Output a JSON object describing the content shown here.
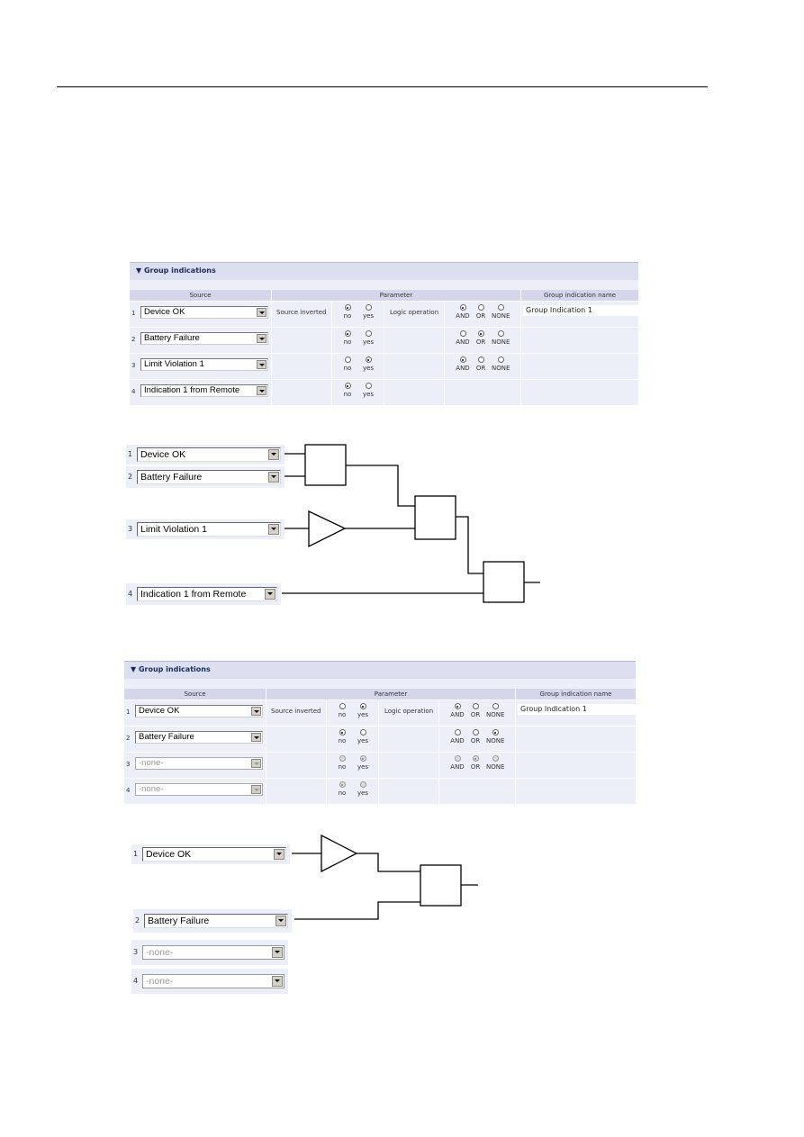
{
  "table1": {
    "title": "▼ Group indications",
    "headers": {
      "source": "Source",
      "parameter": "Parameter",
      "name": "Group indication name"
    },
    "source_inverted_label": "Source inverted",
    "logic_operation_label": "Logic operation",
    "radio_labels": {
      "no": "no",
      "yes": "yes",
      "and": "AND",
      "or": "OR",
      "none": "NONE"
    },
    "group_name": "Group Indication 1",
    "rows": [
      {
        "num": "1",
        "source": "Device OK",
        "inverted": "no",
        "logic": "AND",
        "disabled": false
      },
      {
        "num": "2",
        "source": "Battery Failure",
        "inverted": "no",
        "logic": "OR",
        "disabled": false
      },
      {
        "num": "3",
        "source": "Limit Violation 1",
        "inverted": "yes",
        "logic": "AND",
        "disabled": false
      },
      {
        "num": "4",
        "source": "Indication 1 from Remote",
        "inverted": "no",
        "logic": null,
        "disabled": false
      }
    ]
  },
  "diagram1": {
    "inputs": [
      {
        "num": "1",
        "source": "Device OK"
      },
      {
        "num": "2",
        "source": "Battery Failure"
      },
      {
        "num": "3",
        "source": "Limit Violation 1"
      },
      {
        "num": "4",
        "source": "Indication 1 from Remote"
      }
    ]
  },
  "table2": {
    "title": "▼ Group indications",
    "headers": {
      "source": "Source",
      "parameter": "Parameter",
      "name": "Group indication name"
    },
    "source_inverted_label": "Source inverted",
    "logic_operation_label": "Logic operation",
    "radio_labels": {
      "no": "no",
      "yes": "yes",
      "and": "AND",
      "or": "OR",
      "none": "NONE"
    },
    "group_name": "Group Indication 1",
    "rows": [
      {
        "num": "1",
        "source": "Device OK",
        "inverted": "yes",
        "logic": "AND",
        "disabled": false
      },
      {
        "num": "2",
        "source": "Battery Failure",
        "inverted": "no",
        "logic": "NONE",
        "disabled": false
      },
      {
        "num": "3",
        "source": "-none-",
        "inverted": "yes",
        "logic": "OR",
        "disabled": true
      },
      {
        "num": "4",
        "source": "-none-",
        "inverted": "no",
        "logic": null,
        "disabled": true
      }
    ]
  },
  "diagram2": {
    "inputs": [
      {
        "num": "1",
        "source": "Device OK",
        "disabled": false
      },
      {
        "num": "2",
        "source": "Battery Failure",
        "disabled": false
      },
      {
        "num": "3",
        "source": "-none-",
        "disabled": true
      },
      {
        "num": "4",
        "source": "-none-",
        "disabled": true
      }
    ]
  }
}
